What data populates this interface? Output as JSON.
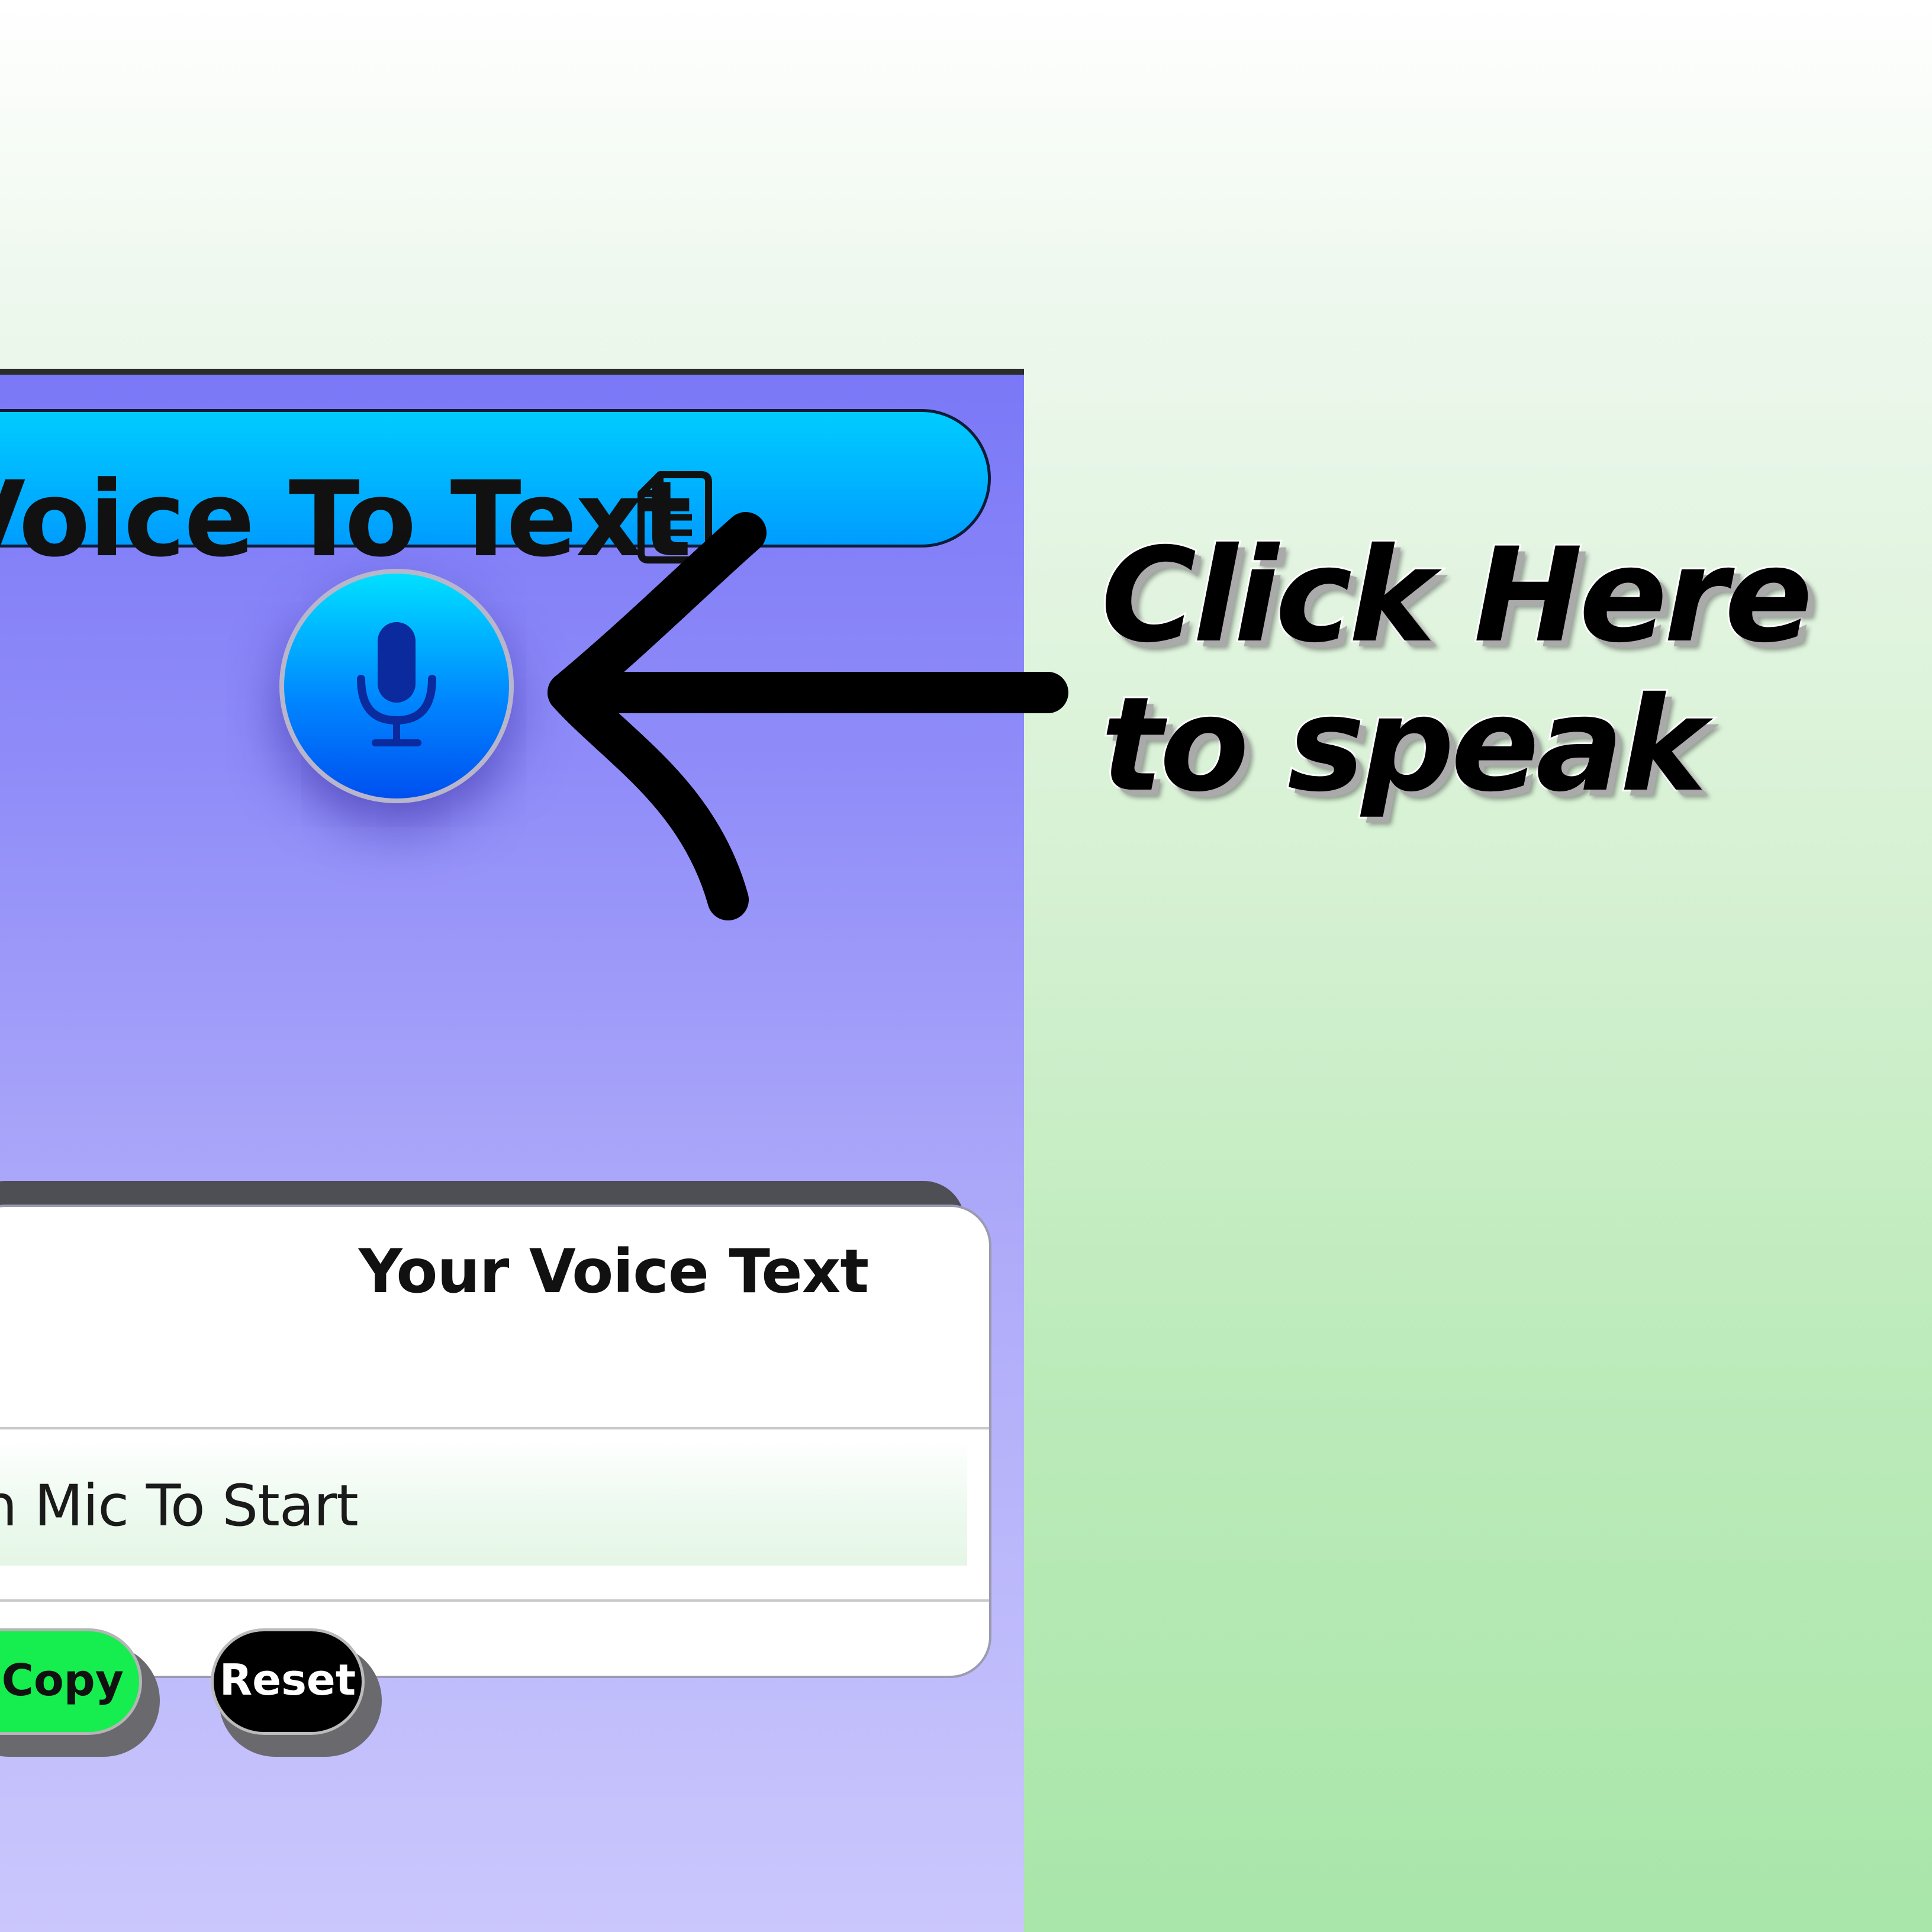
{
  "app": {
    "title": "Voice To Text",
    "title_icons": [
      "microphone-icon",
      "document-icon"
    ]
  },
  "mic_button": {
    "icon": "microphone-icon"
  },
  "text_card": {
    "heading": "Your Voice Text",
    "output_text": "On Mic To Start"
  },
  "actions": {
    "copy_label": "Copy",
    "reset_label": "Reset"
  },
  "annotation": {
    "callout": "Click Here to speak",
    "arrow": "left-arrow"
  },
  "colors": {
    "panel_top": "#7b78f7",
    "panel_bottom": "#cac7fd",
    "title_bar": "#00ccff",
    "mic_button": "#0088ff",
    "copy_button": "#15ee4e",
    "reset_button": "#000000",
    "page_background": "#bdebbb"
  }
}
